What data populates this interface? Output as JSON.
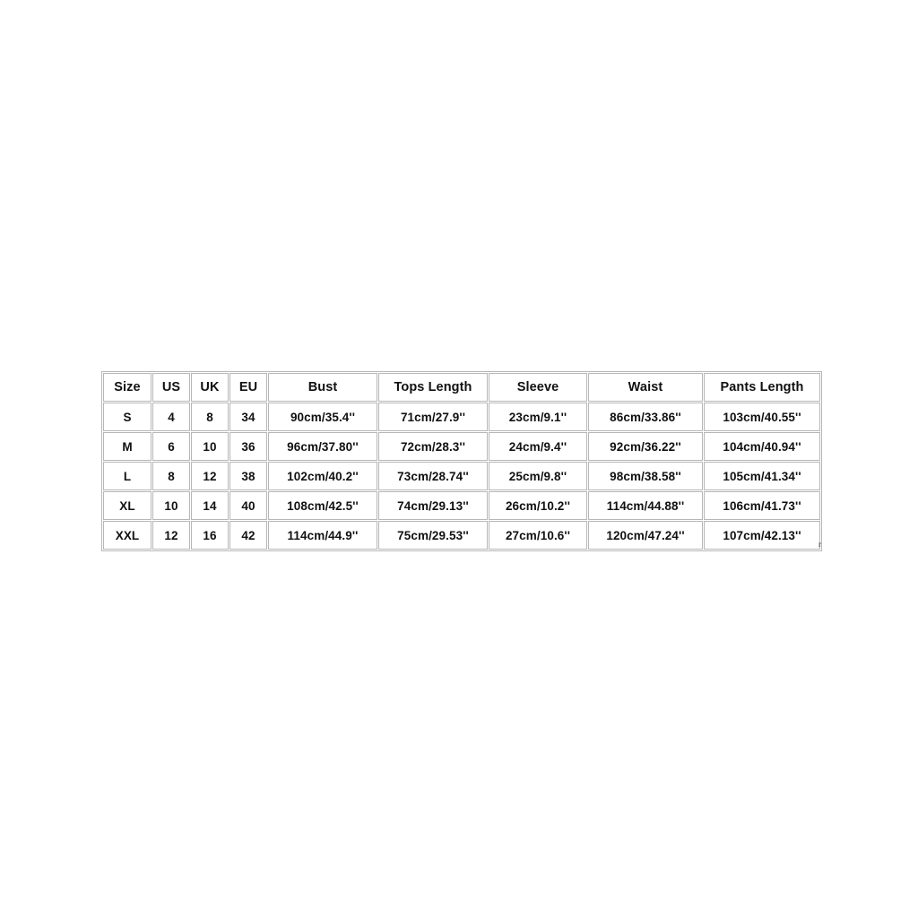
{
  "page": {
    "background_color": "#ffffff",
    "border_color": "#b7b7b7",
    "text_color": "#111111"
  },
  "artifact": {
    "mark": "r"
  },
  "size_chart": {
    "columns": [
      "Size",
      "US",
      "UK",
      "EU",
      "Bust",
      "Tops Length",
      "Sleeve",
      "Waist",
      "Pants Length"
    ],
    "rows": [
      {
        "size": "S",
        "us": "4",
        "uk": "8",
        "eu": "34",
        "bust": "90cm/35.4''",
        "tops_length": "71cm/27.9''",
        "sleeve": "23cm/9.1''",
        "waist": "86cm/33.86''",
        "pants_length": "103cm/40.55''"
      },
      {
        "size": "M",
        "us": "6",
        "uk": "10",
        "eu": "36",
        "bust": "96cm/37.80''",
        "tops_length": "72cm/28.3''",
        "sleeve": "24cm/9.4''",
        "waist": "92cm/36.22''",
        "pants_length": "104cm/40.94''"
      },
      {
        "size": "L",
        "us": "8",
        "uk": "12",
        "eu": "38",
        "bust": "102cm/40.2''",
        "tops_length": "73cm/28.74''",
        "sleeve": "25cm/9.8''",
        "waist": "98cm/38.58''",
        "pants_length": "105cm/41.34''"
      },
      {
        "size": "XL",
        "us": "10",
        "uk": "14",
        "eu": "40",
        "bust": "108cm/42.5''",
        "tops_length": "74cm/29.13''",
        "sleeve": "26cm/10.2''",
        "waist": "114cm/44.88''",
        "pants_length": "106cm/41.73''"
      },
      {
        "size": "XXL",
        "us": "12",
        "uk": "16",
        "eu": "42",
        "bust": "114cm/44.9''",
        "tops_length": "75cm/29.53''",
        "sleeve": "27cm/10.6''",
        "waist": "120cm/47.24''",
        "pants_length": "107cm/42.13''"
      }
    ]
  }
}
